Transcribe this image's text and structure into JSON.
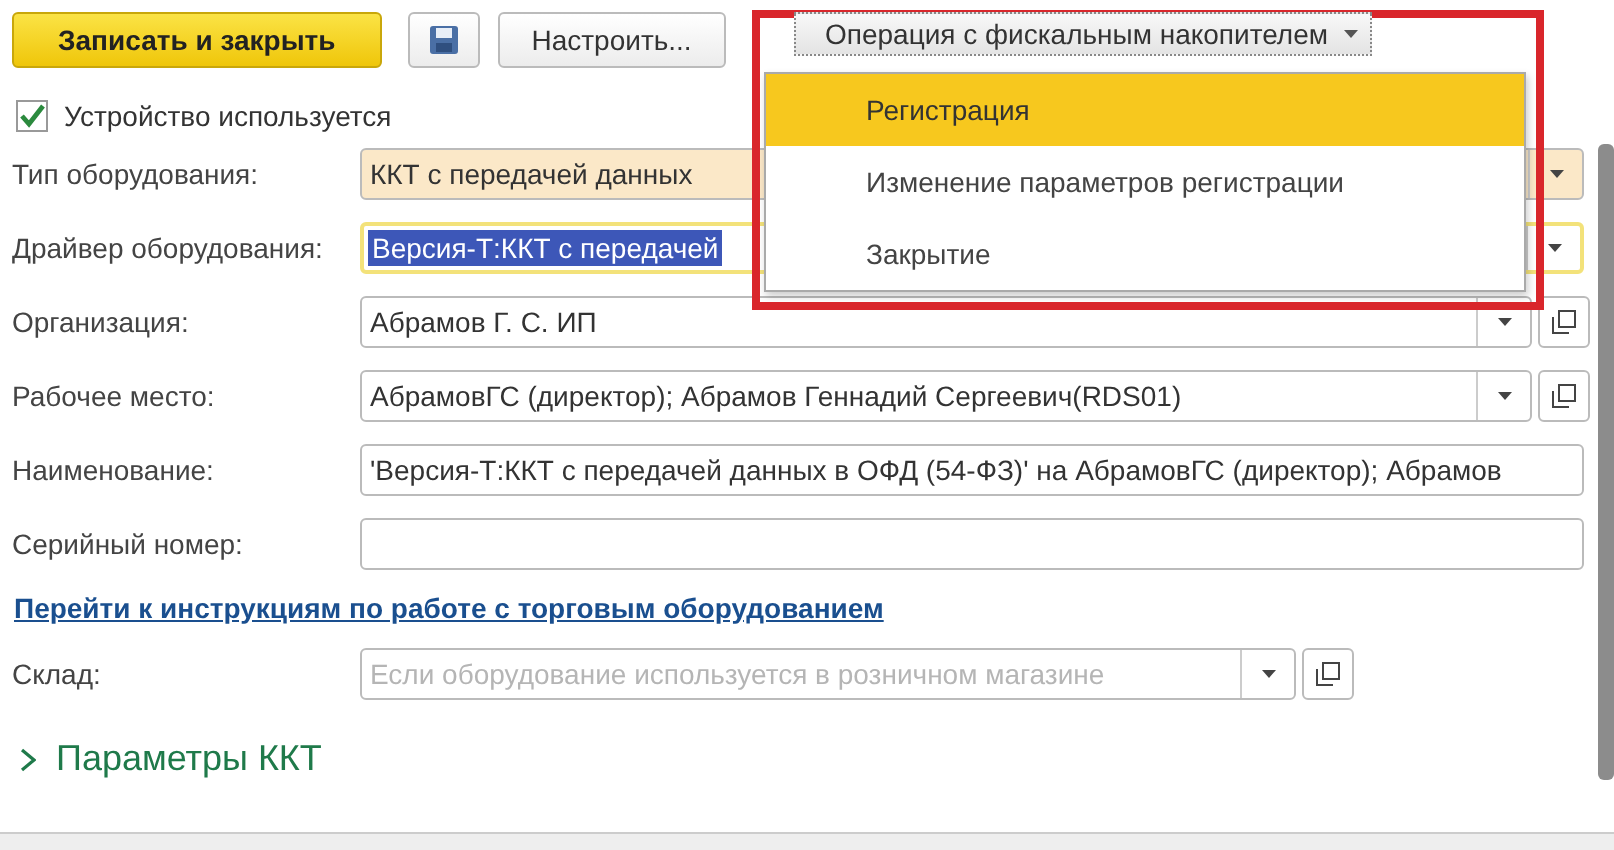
{
  "toolbar": {
    "save_close": "Записать и закрыть",
    "configure": "Настроить...",
    "operation_menu": {
      "label": "Операция с фискальным накопителем",
      "expanded": true,
      "items": [
        {
          "label": "Регистрация",
          "selected": true
        },
        {
          "label": "Изменение параметров регистрации",
          "selected": false
        },
        {
          "label": "Закрытие",
          "selected": false
        }
      ]
    }
  },
  "device_used": {
    "label": "Устройство используется",
    "checked": true
  },
  "fields": [
    {
      "label": "Тип оборудования:",
      "kind": "dropdown",
      "value": "ККТ с передачей данных",
      "highlighted": true,
      "focused": false
    },
    {
      "label": "Драйвер оборудования:",
      "kind": "dropdown",
      "value": "Версия-Т:ККТ с передачей",
      "highlighted": false,
      "focused": true
    },
    {
      "label": "Организация:",
      "kind": "dropdown_open",
      "value": "Абрамов Г. С. ИП",
      "highlighted": false,
      "focused": false
    },
    {
      "label": "Рабочее место:",
      "kind": "dropdown_open",
      "value": "АбрамовГС (директор); Абрамов Геннадий Сергеевич(RDS01)",
      "highlighted": false,
      "focused": false
    },
    {
      "label": "Наименование:",
      "kind": "text",
      "value": "'Версия-Т:ККТ с передачей данных в ОФД (54-ФЗ)' на АбрамовГС (директор); Абрамов",
      "highlighted": false,
      "focused": false
    },
    {
      "label": "Серийный номер:",
      "kind": "text",
      "highlighted": false,
      "focused": false
    }
  ],
  "link": "Перейти к инструкциям по работе с торговым оборудованием",
  "warehouse": {
    "label": "Склад:",
    "placeholder": "Если оборудование используется в розничном магазине"
  },
  "section": {
    "title": "Параметры ККТ",
    "expanded": false
  }
}
